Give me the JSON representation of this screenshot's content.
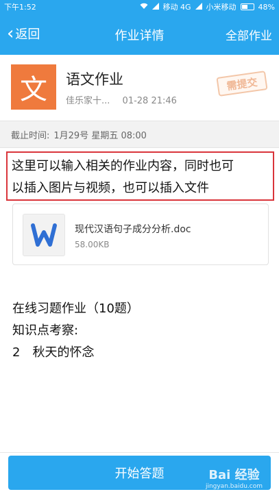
{
  "status_bar": {
    "time": "下午1:52",
    "carrier1": "移动 4G",
    "carrier2": "小米移动",
    "battery": "48%"
  },
  "nav": {
    "back_label": "返回",
    "title": "作业详情",
    "right_label": "全部作业"
  },
  "homework": {
    "subject_icon_char": "文",
    "title": "语文作业",
    "author": "佳乐家十...",
    "datetime": "01-28 21:46",
    "stamp": "需提交"
  },
  "deadline": {
    "label": "截止时间:",
    "value": "1月29号 星期五 08:00"
  },
  "content": {
    "line1": "这里可以输入相关的作业内容，同时也可",
    "line2": "以插入图片与视频，也可以插入文件"
  },
  "attachment": {
    "name": "现代汉语句子成分分析.doc",
    "size": "58.00KB"
  },
  "exercise": {
    "heading": "在线习题作业（10题）",
    "knowledge_label": "知识点考察:",
    "item_number": "2",
    "item_name": "秋天的怀念"
  },
  "bottom": {
    "start_label": "开始答题"
  },
  "watermark": {
    "main": "Bai 经验",
    "sub": "jingyan.baidu.com"
  },
  "colors": {
    "primary": "#2aa7ee",
    "subject_orange": "#ef7a3d",
    "highlight_red": "#d9343a"
  }
}
